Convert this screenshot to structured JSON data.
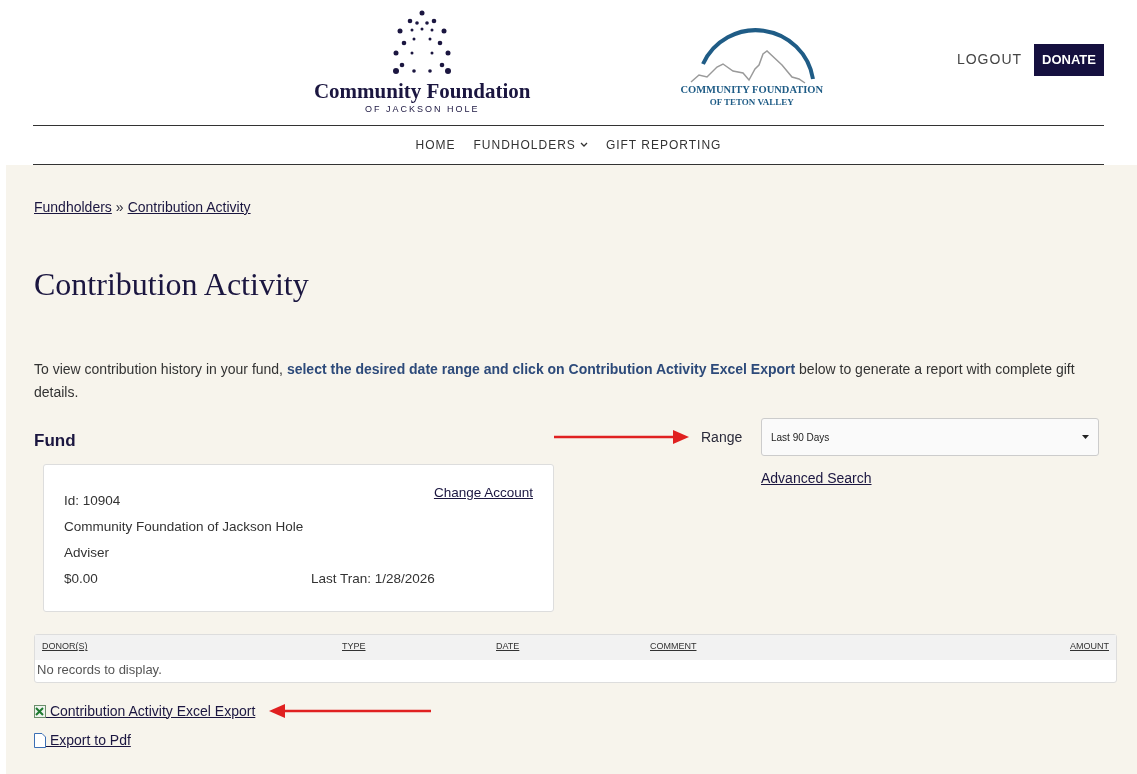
{
  "header": {
    "logo_left": {
      "title": "Community Foundation",
      "subtitle": "OF JACKSON HOLE"
    },
    "logo_right": {
      "title": "COMMUNITY FOUNDATION",
      "subtitle": "OF TETON VALLEY"
    },
    "logout": "LOGOUT",
    "donate": "DONATE"
  },
  "nav": [
    {
      "label": "HOME",
      "dropdown": false
    },
    {
      "label": "FUNDHOLDERS",
      "dropdown": true
    },
    {
      "label": "GIFT REPORTING",
      "dropdown": false
    }
  ],
  "breadcrumb": {
    "items": [
      "Fundholders",
      "Contribution Activity"
    ],
    "separator": "»"
  },
  "title": "Contribution Activity",
  "intro": "To view contribution history in your fund, **select the desired date range and click on Contribution Activity Excel Export** below to generate a report with complete gift details.",
  "fund": {
    "heading": "Fund",
    "change_account": "Change Account",
    "id": "Id: 10904",
    "name": "Community Foundation of Jackson Hole",
    "role": "Adviser",
    "balance": "$0.00",
    "last_tran": "Last Tran: 1/28/2026"
  },
  "range": {
    "label": "Range",
    "value": "Last 90 Days",
    "advanced_search": "Advanced Search"
  },
  "table": {
    "columns": [
      "DONOR(S)",
      "TYPE",
      "DATE",
      "COMMENT",
      "AMOUNT"
    ],
    "empty": "No records to display."
  },
  "exports": [
    {
      "kind": "excel",
      "label": " Contribution Activity Excel Export"
    },
    {
      "kind": "pdf",
      "label": " Export to Pdf"
    }
  ],
  "annotations": [
    {
      "kind": "arrow_right"
    },
    {
      "kind": "arrow_left"
    }
  ]
}
